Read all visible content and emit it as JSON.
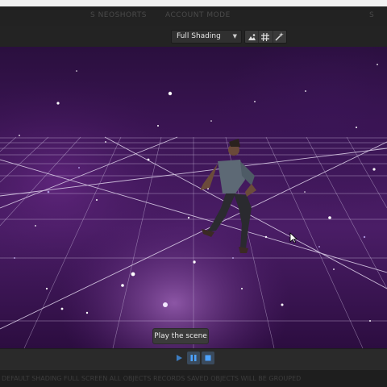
{
  "header": {
    "left_text": "S  NEOSHORTS",
    "middle_text": "ACCOUNT MODE",
    "right_text": "S"
  },
  "toolbar": {
    "shading_mode": "Full Shading",
    "buttons": [
      "image-icon",
      "grid-icon",
      "magic-wand-icon"
    ]
  },
  "scene": {
    "background": "purple-starfield",
    "object": "dancing-figure"
  },
  "tooltip": {
    "text": "Play the scene"
  },
  "playback": {
    "controls": [
      "play-icon",
      "pause-icon",
      "stop-icon"
    ],
    "active": [
      "pause",
      "stop"
    ],
    "accent": "#4da3ff"
  },
  "status_bar": {
    "text": "DEFAULT SHADING FULL SCREEN ALL OBJECTS RECORDS SAVED OBJECTS WILL BE GROUPED"
  }
}
